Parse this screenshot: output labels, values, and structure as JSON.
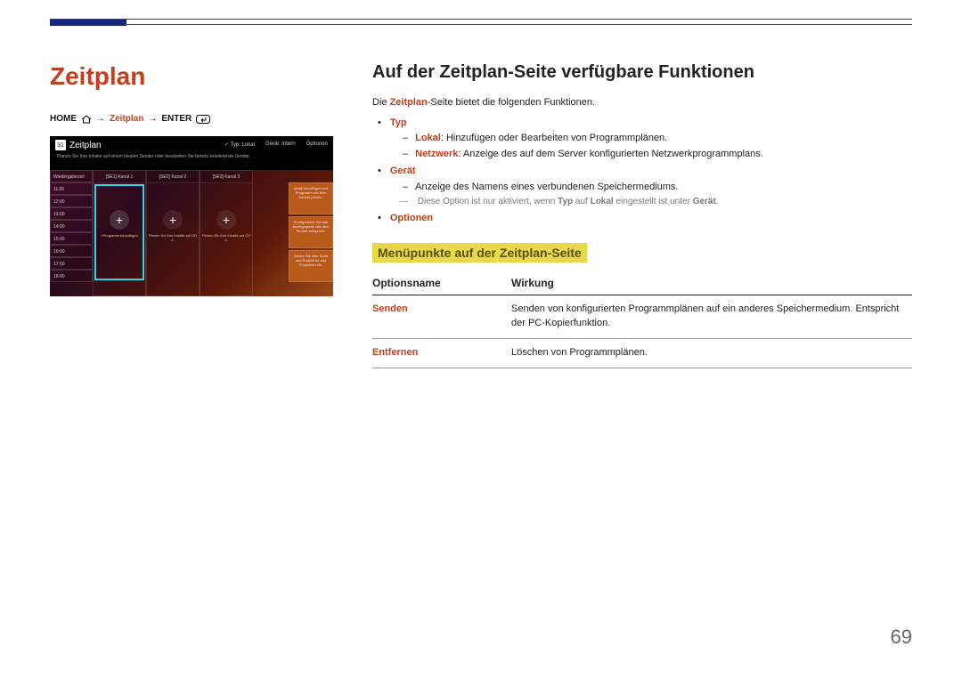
{
  "page_number": "69",
  "left": {
    "title": "Zeitplan",
    "breadcrumb": {
      "home": "HOME",
      "item": "Zeitplan",
      "enter": "ENTER",
      "arrow": "→"
    },
    "screenshot": {
      "title": "Zeitplan",
      "cal_day": "31",
      "subtitle": "Planen Sie Ihre Inhalte auf einem lokalen Sender oder bearbeiten Sie bereits existierende Sender.",
      "topright": {
        "typ": "Typ: Lokal",
        "geraet": "Gerät: Intern",
        "optionen": "Optionen"
      },
      "time_header": "Wiedergabezeit",
      "times": [
        "11:00",
        "12:00",
        "13:00",
        "14:00",
        "15:00",
        "16:00",
        "17:00",
        "18:00"
      ],
      "channels": [
        {
          "head": "[SE1] Kanal 1",
          "plus": "+",
          "caption": "+Programm hinzufügen"
        },
        {
          "head": "[SE2] Kanal 2",
          "plus": "+",
          "caption": "Planen Sie Ihre Inhalte auf CH 2."
        },
        {
          "head": "[SE3] Kanal 3",
          "plus": "+",
          "caption": "Planen Sie Ihre Inhalte auf CH 3."
        }
      ],
      "sidebar": [
        "Inhalt hinzufügen und Programm auf dem Sender planen.",
        "Konfigurieren Sie das Anzeigegerät, das dem Sender entspricht.",
        "Geben Sie eine Taste und Endzeit für das Programm ein."
      ]
    }
  },
  "right": {
    "h2": "Auf der Zeitplan-Seite verfügbare Funktionen",
    "intro_pre": "Die ",
    "intro_hl": "Zeitplan",
    "intro_post": "-Seite bietet die folgenden Funktionen.",
    "bullets": {
      "typ": "Typ",
      "typ_lokal_b": "Lokal",
      "typ_lokal_t": ": Hinzufügen oder Bearbeiten von Programmplänen.",
      "typ_netz_b": "Netzwerk",
      "typ_netz_t": ": Anzeige des auf dem Server konfigurierten Netzwerkprogrammplans.",
      "geraet": "Gerät",
      "geraet_t": "Anzeige des Namens eines verbundenen Speichermediums.",
      "note_pre": "Diese Option ist nur aktiviert, wenn ",
      "note_mid1": "Typ",
      "note_mid2": " auf ",
      "note_mid3": "Lokal",
      "note_mid4": " eingestellt ist unter ",
      "note_mid5": "Gerät",
      "note_end": ".",
      "optionen": "Optionen"
    },
    "sub_h": "Menüpunkte auf der Zeitplan-Seite",
    "table": {
      "col1": "Optionsname",
      "col2": "Wirkung",
      "rows": [
        {
          "name": "Senden",
          "desc": "Senden von konfigurierten Programmplänen auf ein anderes Speichermedium. Entspricht der PC-Kopierfunktion."
        },
        {
          "name": "Entfernen",
          "desc": "Löschen von Programmplänen."
        }
      ]
    }
  }
}
